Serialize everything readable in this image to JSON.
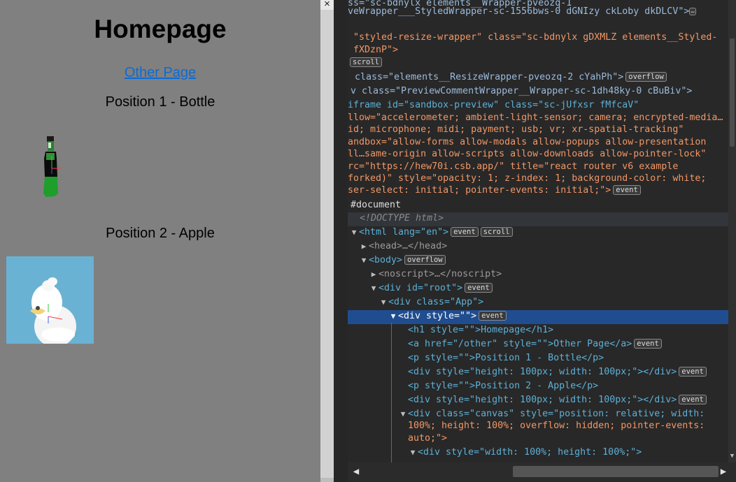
{
  "preview": {
    "heading": "Homepage",
    "link": "Other Page",
    "position1": "Position 1 - Bottle",
    "position2": "Position 2 - Apple"
  },
  "divider": {
    "close_icon": "×"
  },
  "devtools": {
    "lines": [
      {
        "t": "ss=\"sc-bdnylx elements__Wrapper-pveozq-1"
      },
      {
        "t": "veWrapper___StyledWrapper-sc-1556bws-0 dGNIzy ckLoby dkDLCV\">"
      },
      {
        "t": "\"styled-resize-wrapper\" class=\"sc-bdnylx gDXMLZ elements__Styled-"
      },
      {
        "t": "fXDznP\">"
      },
      {
        "t": "scroll"
      },
      {
        "t": "class=\"elements__ResizeWrapper-pveozq-2 cYahPh\">"
      },
      {
        "t": "v class=\"PreviewCommentWrapper__Wrapper-sc-1dh48ky-0 cBuBiv\">"
      },
      {
        "t": "iframe id=\"sandbox-preview\" class=\"sc-jUfxsr fMfcaV\""
      },
      {
        "t": "llow=\"accelerometer; ambient-light-sensor; camera; encrypted-media…"
      },
      {
        "t": "id; microphone; midi; payment; usb; vr; xr-spatial-tracking\""
      },
      {
        "t": "andbox=\"allow-forms allow-modals allow-popups allow-presentation"
      },
      {
        "t": "ll…same-origin allow-scripts allow-downloads allow-pointer-lock\""
      },
      {
        "t": "rc=\"https://hew70i.csb.app/\" title=\"react router v6 example"
      },
      {
        "t": "forked)\" style=\"opacity: 1; z-index: 1; background-color: white;"
      },
      {
        "t": "ser-select: initial; pointer-events: initial;\">"
      },
      {
        "t": "#document"
      },
      {
        "t": "<!DOCTYPE html>"
      },
      {
        "t": "<html lang=\"en\">"
      },
      {
        "t": "<head>…</head>"
      },
      {
        "t": "<body>"
      },
      {
        "t": "<noscript>…</noscript>"
      },
      {
        "t": "<div id=\"root\">"
      },
      {
        "t": "<div class=\"App\">"
      },
      {
        "t": "<div style=\"\">"
      },
      {
        "t": "<h1 style=\"\">Homepage</h1>"
      },
      {
        "t": "<a href=\"/other\" style=\"\">Other Page</a>"
      },
      {
        "t": "<p style=\"\">Position 1 - Bottle</p>"
      },
      {
        "t": "<div style=\"height: 100px; width: 100px;\"></div>"
      },
      {
        "t": "<p style=\"\">Position 2 - Apple</p>"
      },
      {
        "t": "<div style=\"height: 100px; width: 100px;\"></div>"
      },
      {
        "t": "<div class=\"canvas\" style=\"position: relative; width:"
      },
      {
        "t": "100%; height: 100%; overflow: hidden; pointer-events:"
      },
      {
        "t": "auto;\">"
      },
      {
        "t": "<div style=\"width: 100%; height: 100%;\">"
      }
    ],
    "badges": {
      "ellipsis": "…",
      "scroll": "scroll",
      "overflow": "overflow",
      "event": "event"
    }
  },
  "colors": {
    "preview_bg": "#808080",
    "link": "#0b6bd6",
    "devtools_bg": "#282828",
    "selected_row": "#1f4d8f",
    "tag": "#5db0d7",
    "attr_name": "#9bbbdc",
    "attr_value": "#f29766"
  },
  "icons": {
    "expand": "expand-triangle-icon",
    "collapse": "collapse-triangle-icon",
    "scroll_left": "chevron-left-icon",
    "scroll_right": "chevron-right-icon"
  }
}
